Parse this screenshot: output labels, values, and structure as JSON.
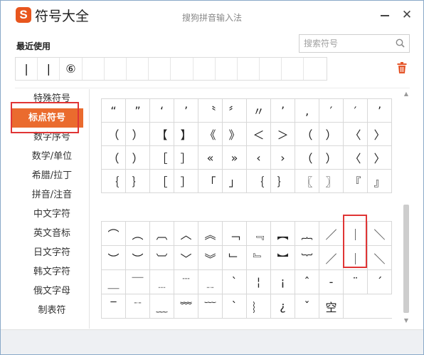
{
  "app": {
    "logo_letter": "S",
    "title": "符号大全",
    "window_title": "搜狗拼音输入法",
    "close_glyph": "✕"
  },
  "recent": {
    "label": "最近使用",
    "items": [
      "|",
      "❘",
      "⑥",
      "",
      "",
      "",
      "",
      "",
      "",
      "",
      "",
      "",
      "",
      ""
    ]
  },
  "search": {
    "placeholder": "搜索符号",
    "icon": "search-icon"
  },
  "categories": [
    "特殊符号",
    "标点符号",
    "数字序号",
    "数学/单位",
    "希腊/拉丁",
    "拼音/注音",
    "中文字符",
    "英文音标",
    "日文字符",
    "韩文字符",
    "俄文字母",
    "制表符"
  ],
  "active_category": "标点符号",
  "punctuation_grid": [
    [
      "“",
      "”",
      "‘",
      "’",
      "〝",
      "〞",
      "〃",
      "’",
      "‚",
      "′",
      "′",
      "’"
    ],
    [
      "（",
      "）",
      "【",
      "】",
      "《",
      "》",
      "＜",
      "＞",
      "（",
      "）",
      "〈",
      "〉"
    ],
    [
      "（",
      "）",
      "［",
      "］",
      "«",
      "»",
      "‹",
      "›",
      "（",
      "）",
      "〈",
      "〉"
    ],
    [
      "｛",
      "｝",
      "［",
      "］",
      "「",
      "」",
      "｛",
      "｝",
      "〖",
      "〗",
      "『",
      "』"
    ]
  ],
  "symbol_grid": [
    [
      "⌒",
      "︵",
      "︹",
      "︿",
      "︽",
      "﹁",
      "﹃",
      "︻",
      "︷",
      "／",
      "｜",
      "＼"
    ],
    [
      "︶",
      "︶",
      "︺",
      "﹀",
      "︾",
      "﹂",
      "﹄",
      "︼",
      "︸",
      "／",
      "｜",
      "＼"
    ],
    [
      "＿",
      "￣",
      "﹍",
      "﹉",
      "﹎",
      "ˋ",
      "¦",
      "¡",
      "ˆ",
      "-",
      "¨",
      "ˊ"
    ],
    [
      "‾",
      "﹊",
      "﹏",
      "﹌",
      "﹋",
      "ˋ",
      "︴",
      "¿",
      "ˇ",
      "空"
    ]
  ],
  "colors": {
    "accent": "#ea6b2e",
    "highlight": "#e03535",
    "trash": "#e5572b"
  }
}
